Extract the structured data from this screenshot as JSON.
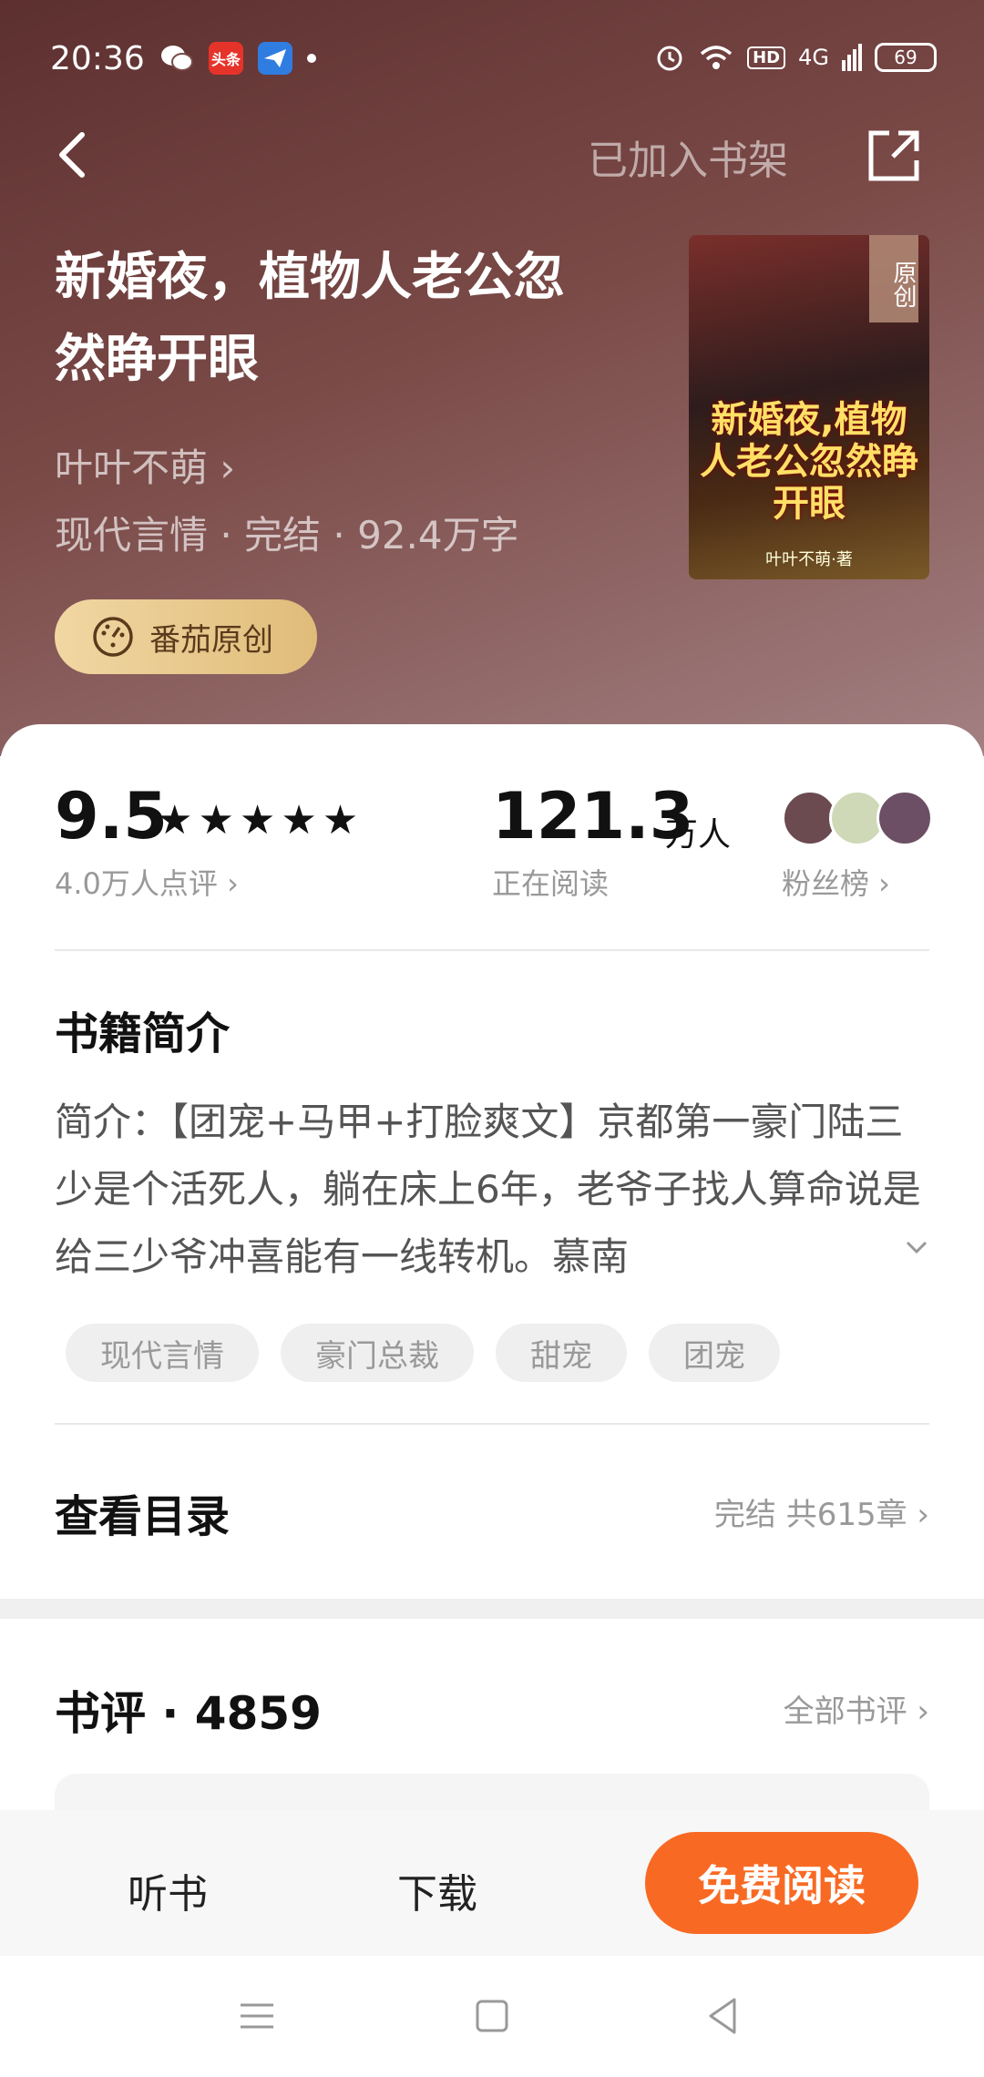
{
  "status_bar": {
    "time": "20:36",
    "apps": [
      {
        "name": "wechat-icon",
        "label": "",
        "color": "#ffffff"
      },
      {
        "name": "toutiao-icon",
        "label": "头条",
        "color": "#e6332a"
      },
      {
        "name": "mail-icon",
        "label": "",
        "color": "#2f7de1"
      }
    ],
    "hd": "HD",
    "network": "4G",
    "battery": "69"
  },
  "header": {
    "shelf_label": "已加入书架"
  },
  "book": {
    "title": "新婚夜，植物人老公忽然睁开眼",
    "author": "叶叶不萌 ›",
    "meta": "现代言情 · 完结 · 92.4万字",
    "badge": "番茄原创",
    "cover": {
      "badge": "原创",
      "title": "新婚夜,植物人老公忽然睁开眼",
      "author": "叶叶不萌·著"
    }
  },
  "stats": {
    "score": "9.5",
    "stars": "★★★★★",
    "reviews": "4.0万人点评 ›",
    "readers": "121.3",
    "readers_unit": "万人",
    "reading_label": "正在阅读",
    "fans_label": "粉丝榜 ›"
  },
  "intro": {
    "title": "书籍简介",
    "text": "简介：【团宠+马甲+打脸爽文】京都第一豪门陆三少是个活死人，躺在床上6年，老爷子找人算命说是给三少爷冲喜能有一线转机。慕南",
    "tags": [
      "现代言情",
      "豪门总裁",
      "甜宠",
      "团宠"
    ]
  },
  "catalog": {
    "title": "查看目录",
    "info": "完结 共615章 ›"
  },
  "book_reviews": {
    "title": "书评 · 4859",
    "all_label": "全部书评 ›"
  },
  "bottom_bar": {
    "listen": "听书",
    "download": "下载",
    "read": "免费阅读"
  },
  "colors": {
    "accent": "#f86a24",
    "hero": "#6e3e3c",
    "badge_gold": "#e8c88a"
  }
}
